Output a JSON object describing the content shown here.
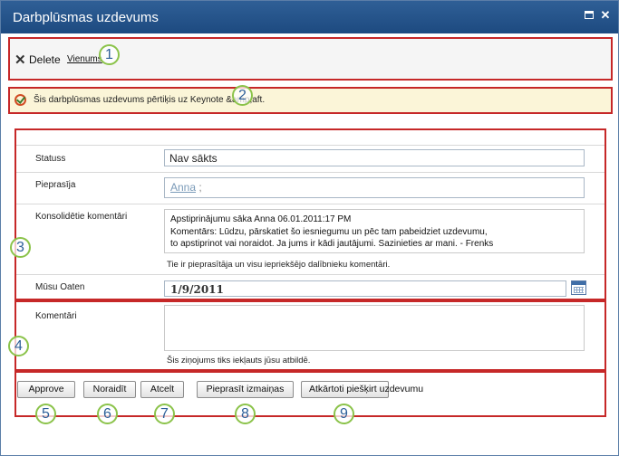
{
  "window": {
    "title": "Darbplūsmas uzdevums",
    "maximize_icon": "maximize-icon",
    "close_icon": "close-icon",
    "close_glyph": "✕"
  },
  "ribbon": {
    "delete_label": "Delete",
    "item_label": "Vienums",
    "delete_icon": "close-x-icon",
    "delete_glyph": "✕"
  },
  "info": {
    "icon": "check-circle-icon",
    "message": "Šis darbplūsmas uzdevums pērtiķis uz Keynote &amp;aft."
  },
  "form": {
    "status_label": "Statuss",
    "status_value": "Nav sākts",
    "requested_by_label": "Pieprasīja",
    "requested_by_person": "Anna",
    "requested_by_sep": ";",
    "consolidated_label": "Konsolidētie komentāri",
    "consolidated_lines": [
      "Apstiprinājumu sāka Anna 06.01.2011:17 PM",
      "Komentārs: Lūdzu, pārskatiet šo iesniegumu un pēc tam pabeidziet uzdevumu,",
      "to apstiprinot vai noraidot. Ja jums ir kādi jautājumi. Sazinieties ar mani. - Frenks"
    ],
    "consolidated_hint": "Tie ir pieprasītāja un visu iepriekšējo dalībnieku komentāri.",
    "due_label": "Mūsu Oaten",
    "due_value": "1/9/2011",
    "calendar_icon": "calendar-icon",
    "comments_label": "Komentāri",
    "comments_value": "",
    "comments_hint": "Šis ziņojums tiks iekļauts jūsu atbildē."
  },
  "buttons": {
    "approve": "Approve",
    "reject": "Noraidīt",
    "cancel": "Atcelt",
    "request_change": "Pieprasīt izmaiņas",
    "reassign": "Atkārtoti piešķirt uzdevumu"
  },
  "callouts": [
    "1",
    "2",
    "3",
    "4",
    "5",
    "6",
    "7",
    "8",
    "9"
  ],
  "colors": {
    "titlebar": "#1d4a80",
    "highlight_border": "#c62828",
    "callout_ring": "#8bc34a",
    "callout_text": "#2d5f99",
    "info_bg": "#fbf5d8"
  }
}
